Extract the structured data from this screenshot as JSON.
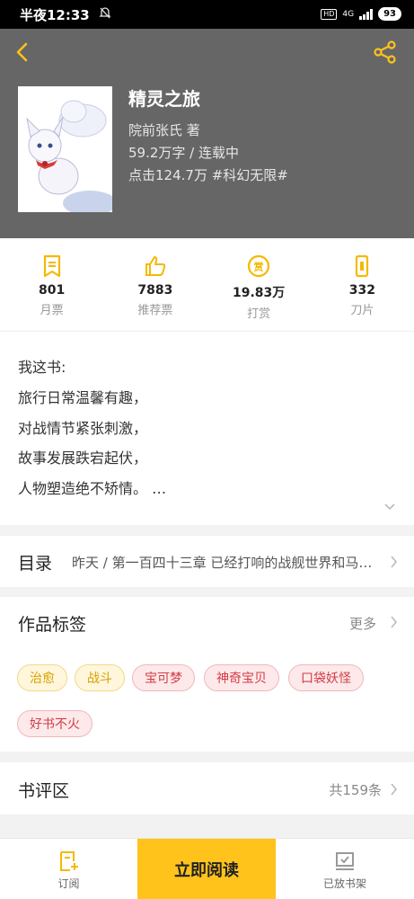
{
  "status_bar": {
    "time": "半夜12:33",
    "hd": "HD",
    "network": "4G",
    "battery": "93"
  },
  "book": {
    "title": "精灵之旅",
    "author": "院前张氏 著",
    "word_status": "59.2万字 / 连载中",
    "clicks_tag": "点击124.7万  #科幻无限#"
  },
  "stats": [
    {
      "icon": "ticket-icon",
      "value": "801",
      "label": "月票"
    },
    {
      "icon": "thumbs-up-icon",
      "value": "7883",
      "label": "推荐票"
    },
    {
      "icon": "reward-coin-icon",
      "value": "19.83万",
      "label": "打赏"
    },
    {
      "icon": "blade-icon",
      "value": "332",
      "label": "刀片"
    }
  ],
  "intro": {
    "lines": [
      "我这书:",
      "旅行日常温馨有趣，",
      "对战情节紧张刺激，",
      "故事发展跌宕起伏，",
      "人物塑造绝不矫情。 …"
    ]
  },
  "catalog": {
    "title": "目录",
    "latest": "昨天 / 第一百四十三章  已经打响的战舰世界和马…"
  },
  "tags": {
    "title": "作品标签",
    "more": "更多",
    "items": [
      {
        "label": "治愈",
        "style": "yellow"
      },
      {
        "label": "战斗",
        "style": "yellow"
      },
      {
        "label": "宝可梦",
        "style": "red"
      },
      {
        "label": "神奇宝贝",
        "style": "red"
      },
      {
        "label": "口袋妖怪",
        "style": "red"
      },
      {
        "label": "好书不火",
        "style": "red"
      }
    ]
  },
  "review": {
    "title": "书评区",
    "count": "共159条"
  },
  "bottom_bar": {
    "subscribe": "订阅",
    "read_now": "立即阅读",
    "shelf": "已放书架"
  },
  "colors": {
    "accent": "#ffc31c",
    "header_bg": "#666666",
    "icon_yellow": "#f5b900"
  }
}
